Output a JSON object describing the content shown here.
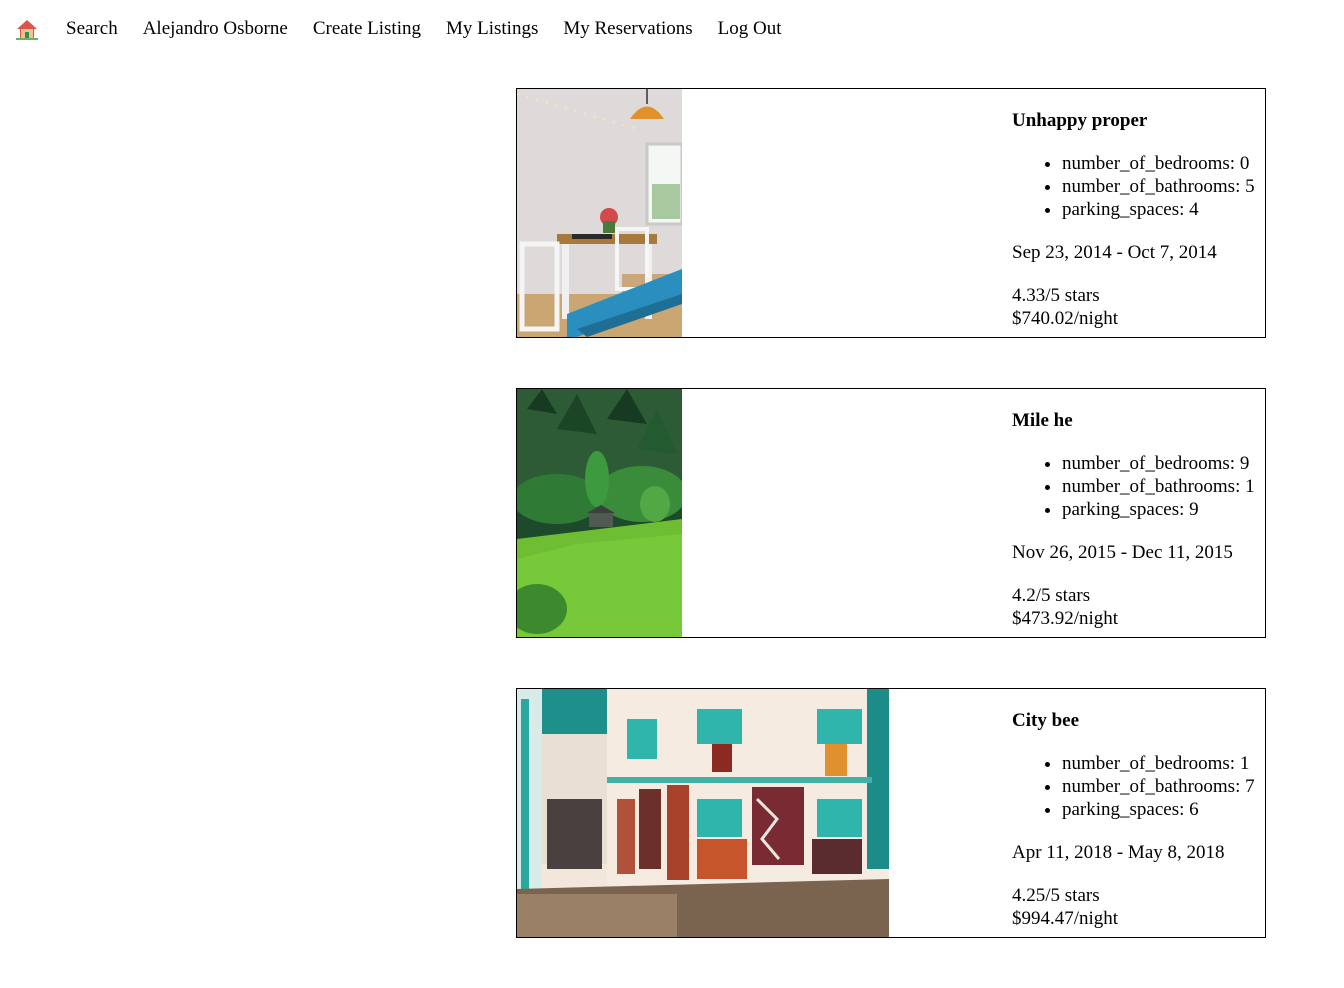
{
  "nav": {
    "home_icon": "house-icon",
    "links": [
      "Search",
      "Alejandro Osborne",
      "Create Listing",
      "My Listings",
      "My Reservations",
      "Log Out"
    ]
  },
  "listings": [
    {
      "title": "Unhappy proper",
      "features": [
        "number_of_bedrooms: 0",
        "number_of_bathrooms: 5",
        "parking_spaces: 4"
      ],
      "dates": "Sep 23, 2014 - Oct 7, 2014",
      "rating": "4.33/5 stars",
      "price": "$740.02/night",
      "image": "dining-room-photo"
    },
    {
      "title": "Mile he",
      "features": [
        "number_of_bedrooms: 9",
        "number_of_bathrooms: 1",
        "parking_spaces: 9"
      ],
      "dates": "Nov 26, 2015 - Dec 11, 2015",
      "rating": "4.2/5 stars",
      "price": "$473.92/night",
      "image": "forest-hillside-photo"
    },
    {
      "title": "City bee",
      "features": [
        "number_of_bedrooms: 1",
        "number_of_bathrooms: 7",
        "parking_spaces: 6"
      ],
      "dates": "Apr 11, 2018 - May 8, 2018",
      "rating": "4.25/5 stars",
      "price": "$994.47/night",
      "image": "street-with-rugs-photo"
    }
  ]
}
